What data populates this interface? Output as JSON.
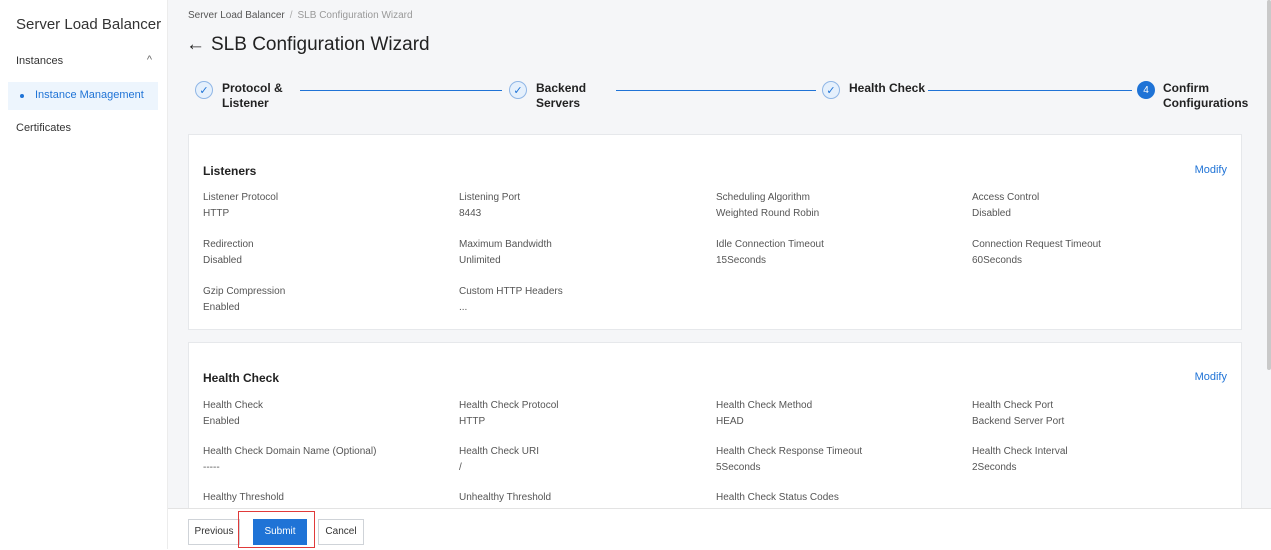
{
  "sidebar": {
    "title": "Server Load Balancer",
    "group": "Instances",
    "group_chevron": "^",
    "active_item": "Instance Management",
    "item_certificates": "Certificates"
  },
  "breadcrumb": {
    "root": "Server Load Balancer",
    "separator": "/",
    "current": "SLB Configuration Wizard"
  },
  "page": {
    "back_icon": "←",
    "title": "SLB Configuration Wizard"
  },
  "steps": [
    {
      "label": "Protocol & Listener",
      "line1": "Protocol &",
      "line2": "Listener",
      "icon": "✓",
      "status": "done"
    },
    {
      "label": "Backend Servers",
      "line1": "Backend",
      "line2": "Servers",
      "icon": "✓",
      "status": "done"
    },
    {
      "label": "Health Check",
      "line1": "Health Check",
      "line2": "",
      "icon": "✓",
      "status": "done"
    },
    {
      "label": "Confirm Configurations",
      "line1": "Confirm",
      "line2": "Configurations",
      "icon": "4",
      "status": "current"
    }
  ],
  "listeners": {
    "title": "Listeners",
    "modify": "Modify",
    "fields": [
      {
        "label": "Listener Protocol",
        "value": "HTTP"
      },
      {
        "label": "Listening Port",
        "value": "8443"
      },
      {
        "label": "Scheduling Algorithm",
        "value": "Weighted Round Robin"
      },
      {
        "label": "Access Control",
        "value": "Disabled"
      },
      {
        "label": "Redirection",
        "value": "Disabled"
      },
      {
        "label": "Maximum Bandwidth",
        "value": "Unlimited"
      },
      {
        "label": "Idle Connection Timeout",
        "value": "15Seconds"
      },
      {
        "label": "Connection Request Timeout",
        "value": "60Seconds"
      },
      {
        "label": "Gzip Compression",
        "value": "Enabled"
      },
      {
        "label": "Custom HTTP Headers",
        "value": "..."
      }
    ]
  },
  "health_check": {
    "title": "Health Check",
    "modify": "Modify",
    "fields": [
      {
        "label": "Health Check",
        "value": "Enabled"
      },
      {
        "label": "Health Check Protocol",
        "value": "HTTP"
      },
      {
        "label": "Health Check Method",
        "value": "HEAD"
      },
      {
        "label": "Health Check Port",
        "value": "Backend Server Port"
      },
      {
        "label": "Health Check Domain Name (Optional)",
        "value": "-----"
      },
      {
        "label": "Health Check URI",
        "value": "/"
      },
      {
        "label": "Health Check Response Timeout",
        "value": "5Seconds"
      },
      {
        "label": "Health Check Interval",
        "value": "2Seconds"
      },
      {
        "label": "Healthy Threshold",
        "value": ""
      },
      {
        "label": "Unhealthy Threshold",
        "value": ""
      },
      {
        "label": "Health Check Status Codes",
        "value": ""
      }
    ]
  },
  "footer": {
    "previous": "Previous",
    "submit": "Submit",
    "cancel": "Cancel"
  },
  "colors": {
    "accent": "#1f73d6",
    "highlight": "#e03a3a"
  }
}
